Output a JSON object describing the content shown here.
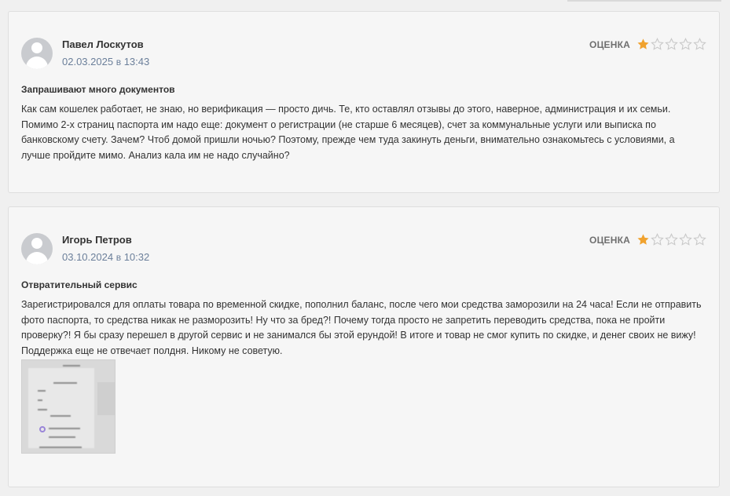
{
  "rating_label": "ОЦЕНКА",
  "colors": {
    "star_filled": "#f0a22e",
    "star_empty": "#c9c9c9",
    "date": "#6b7f9a"
  },
  "reviews": [
    {
      "author": "Павел Лоскутов",
      "date": "02.03.2025",
      "date_sep": "в",
      "time": "13:43",
      "rating": 1,
      "rating_max": 5,
      "title": "Запрашивают много документов",
      "text": "Как сам кошелек работает, не знаю, но верификация — просто дичь. Те, кто оставлял отзывы до этого, наверное, администрация и их семьи. Помимо 2-х страниц паспорта им надо еще: документ о регистрации (не старше 6 месяцев), счет за коммунальные услуги или выписка по банковскому счету. Зачем? Чтоб домой пришли ночью? Поэтому, прежде чем туда закинуть деньги, внимательно ознакомьтесь с условиями, а лучше пройдите мимо. Анализ кала им не надо случайно?",
      "has_attachment": false
    },
    {
      "author": "Игорь Петров",
      "date": "03.10.2024",
      "date_sep": "в",
      "time": "10:32",
      "rating": 1,
      "rating_max": 5,
      "title": "Отвратительный сервис",
      "text": "Зарегистрировался для оплаты товара по временной скидке, пополнил баланс, после чего мои средства заморозили на 24 часа! Если не отправить фото паспорта, то средства никак не разморозить! Ну что за бред?! Почему тогда просто не запретить переводить средства, пока не пройти проверку?! Я бы сразу перешел в другой сервис и не занимался бы этой ерундой! В итоге и товар не смог купить по скидке, и денег своих не вижу! Поддержка еще не отвечает полдня. Никому не советую.",
      "has_attachment": true
    }
  ]
}
